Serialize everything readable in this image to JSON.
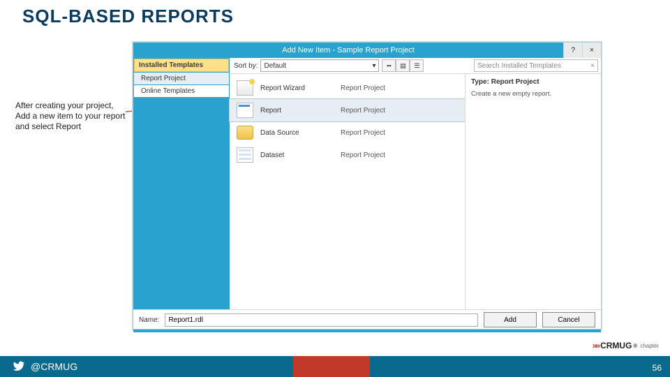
{
  "title": "SQL-BASED REPORTS",
  "callout": "After creating your project, Add a new item to your report and select Report",
  "dialog": {
    "title": "Add New Item - Sample Report Project",
    "help": "?",
    "close": "×",
    "sidebar": {
      "heading": "Installed Templates",
      "items": [
        "Report Project",
        "Online Templates"
      ]
    },
    "toolbar": {
      "sort_label": "Sort by:",
      "sort_value": "Default",
      "search_placeholder": "Search Installed Templates"
    },
    "items": [
      {
        "name": "Report Wizard",
        "category": "Report Project",
        "selected": false,
        "icon": "wiz"
      },
      {
        "name": "Report",
        "category": "Report Project",
        "selected": true,
        "icon": "rpt"
      },
      {
        "name": "Data Source",
        "category": "Report Project",
        "selected": false,
        "icon": "ds"
      },
      {
        "name": "Dataset",
        "category": "Report Project",
        "selected": false,
        "icon": "dset"
      }
    ],
    "details": {
      "type_label": "Type:",
      "type_value": "Report Project",
      "description": "Create a new empty report."
    },
    "footer": {
      "name_label": "Name:",
      "name_value": "Report1.rdl",
      "add": "Add",
      "cancel": "Cancel"
    }
  },
  "footer": {
    "handle": "@CRMUG",
    "page": "56",
    "logo_name": "CRMUG",
    "logo_sub": "chapter"
  }
}
